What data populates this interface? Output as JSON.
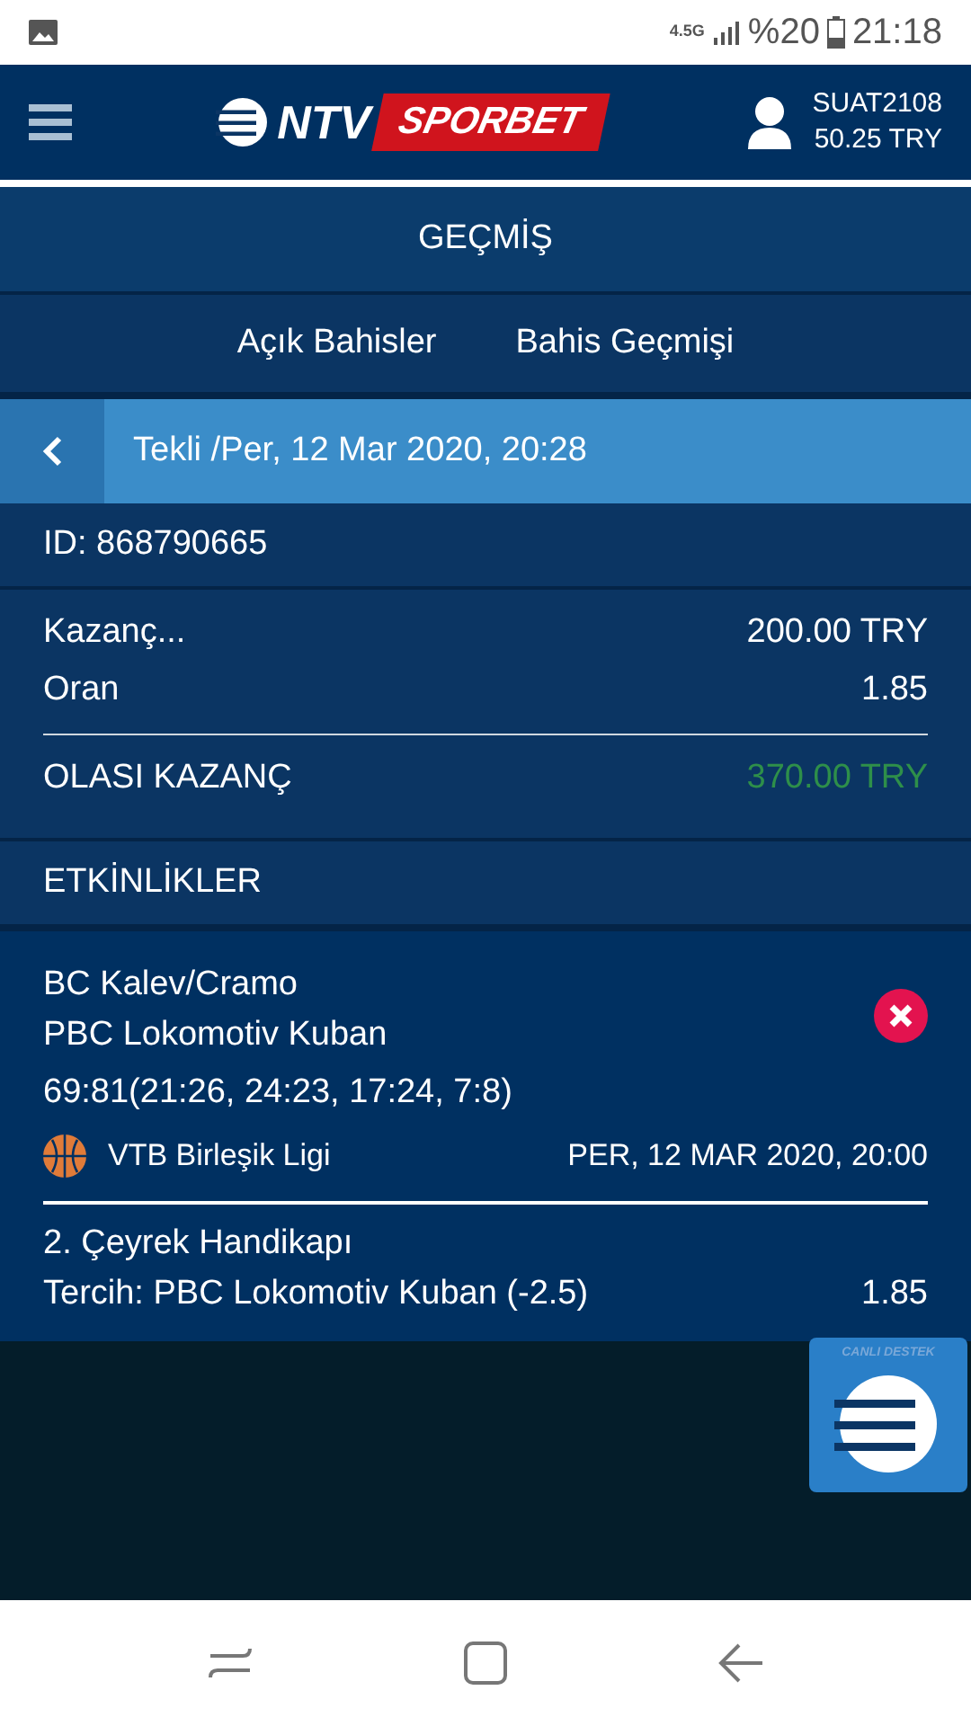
{
  "status_bar": {
    "network": "4.5G",
    "battery": "%20",
    "time": "21:18"
  },
  "header": {
    "logo_left": "NTV",
    "logo_right": "SPORBET",
    "username": "SUAT2108",
    "balance": "50.25 TRY"
  },
  "page_title": "GEÇMİŞ",
  "tabs": [
    {
      "label": "Açık Bahisler",
      "selected": false
    },
    {
      "label": "Bahis Geçmişi",
      "selected": false
    }
  ],
  "bet_header": {
    "title": "Tekli /Per, 12 Mar 2020, 20:28"
  },
  "bet_id": "ID: 868790665",
  "summary": [
    {
      "label": "Kazanç...",
      "value": "200.00 TRY",
      "kind": "plain"
    },
    {
      "label": "Oran",
      "value": "1.85",
      "kind": "plain"
    },
    {
      "label": "OLASI KAZANÇ",
      "value": "370.00 TRY",
      "kind": "win"
    }
  ],
  "events_title": "ETKİNLİKLER",
  "event": {
    "home": "BC Kalev/Cramo",
    "away": "PBC Lokomotiv Kuban",
    "score": "69:81(21:26, 24:23, 17:24, 7:8)",
    "league": "VTB Birleşik Ligi",
    "date": "PER, 12 MAR 2020, 20:00",
    "lost": true,
    "market": "2. Çeyrek Handikapı",
    "pick": "Tercih: PBC Lokomotiv Kuban (-2.5)",
    "odds": "1.85"
  },
  "live_support": {
    "label": "CANLI DESTEK"
  }
}
